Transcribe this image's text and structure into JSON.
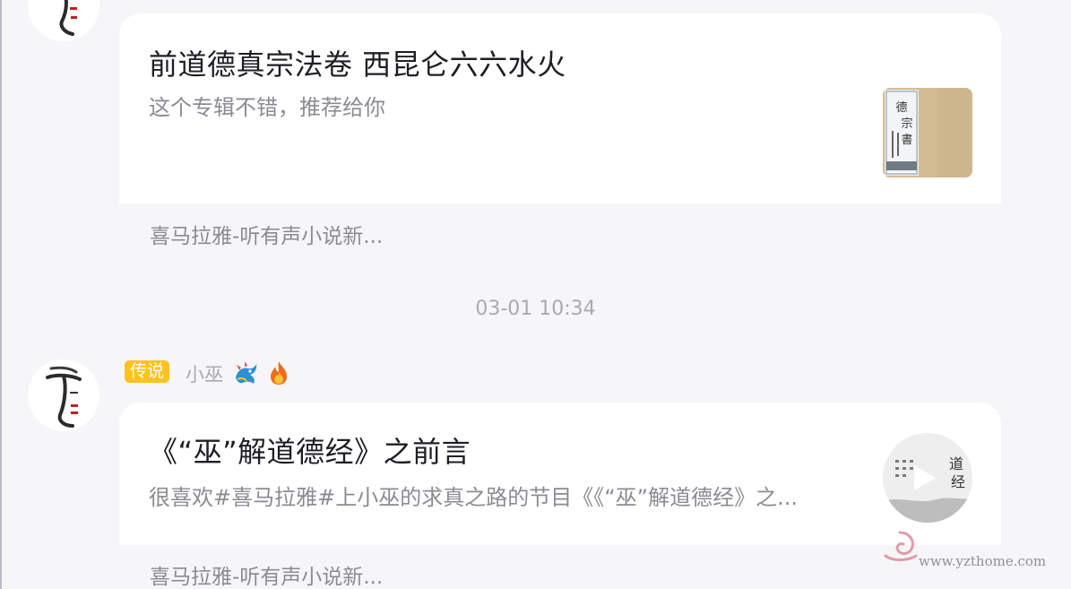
{
  "feed": {
    "items": [
      {
        "title": "前道德真宗法卷 西昆仑六六水火",
        "subtitle": "这个专辑不错，推荐给你",
        "source": "喜马拉雅-听有声小说新..."
      },
      {
        "badge": "传说",
        "username": "小巫",
        "title": "《“巫”解道德经》之前言",
        "subtitle": "很喜欢#喜马拉雅#上小巫的求真之路的节目《《“巫”解道德经》之...",
        "source": "喜马拉雅-听有声小说新..."
      }
    ],
    "timestamp": "03-01 10:34"
  },
  "watermark": "www.yzthome.com",
  "colors": {
    "badge": "#ffc21f",
    "background": "#f6f6f8",
    "card": "#ffffff"
  },
  "icons": {
    "avatar": "calligraphy-avatar-icon",
    "dragon": "dragon-icon",
    "fire": "fire-icon",
    "play": "play-icon"
  }
}
